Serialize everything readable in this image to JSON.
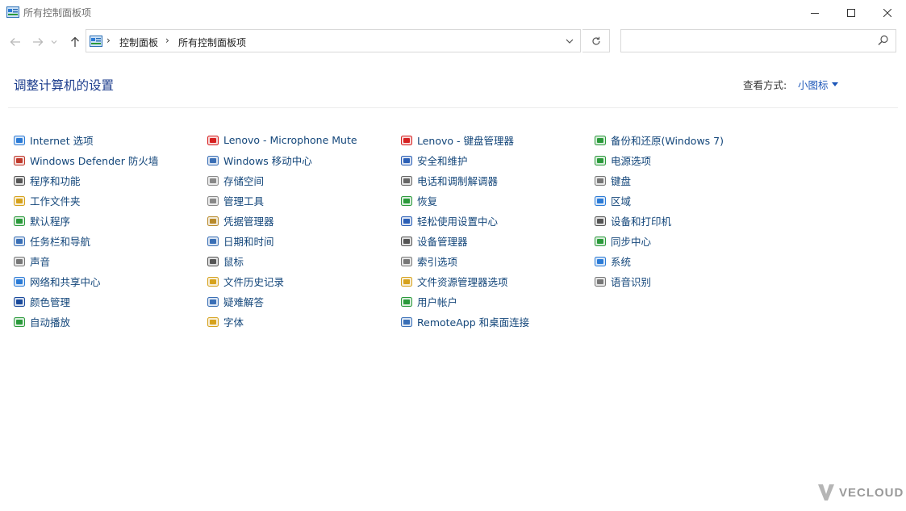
{
  "window": {
    "title": "所有控制面板项"
  },
  "address": {
    "crumbs": [
      "控制面板",
      "所有控制面板项"
    ],
    "search_placeholder": ""
  },
  "header": {
    "title": "调整计算机的设置",
    "view_label": "查看方式:",
    "view_value": "小图标"
  },
  "items": [
    {
      "label": "Internet 选项",
      "icon": "internet-options-icon",
      "color": "#2b7bd6"
    },
    {
      "label": "Windows Defender 防火墙",
      "icon": "firewall-icon",
      "color": "#c0392b"
    },
    {
      "label": "程序和功能",
      "icon": "programs-icon",
      "color": "#555"
    },
    {
      "label": "工作文件夹",
      "icon": "work-folders-icon",
      "color": "#d6a21c"
    },
    {
      "label": "默认程序",
      "icon": "default-programs-icon",
      "color": "#2b9a3b"
    },
    {
      "label": "任务栏和导航",
      "icon": "taskbar-icon",
      "color": "#3a6fb6"
    },
    {
      "label": "声音",
      "icon": "sound-icon",
      "color": "#777"
    },
    {
      "label": "网络和共享中心",
      "icon": "network-icon",
      "color": "#2b7bd6"
    },
    {
      "label": "颜色管理",
      "icon": "color-management-icon",
      "color": "#1a4a9c"
    },
    {
      "label": "自动播放",
      "icon": "autoplay-icon",
      "color": "#2b9a3b"
    },
    {
      "label": "Lenovo - Microphone Mute",
      "icon": "microphone-mute-icon",
      "color": "#d62020"
    },
    {
      "label": "Windows 移动中心",
      "icon": "mobility-center-icon",
      "color": "#3a6fb6"
    },
    {
      "label": "存储空间",
      "icon": "storage-spaces-icon",
      "color": "#888"
    },
    {
      "label": "管理工具",
      "icon": "admin-tools-icon",
      "color": "#888"
    },
    {
      "label": "凭据管理器",
      "icon": "credential-manager-icon",
      "color": "#b88a2b"
    },
    {
      "label": "日期和时间",
      "icon": "date-time-icon",
      "color": "#3a6fb6"
    },
    {
      "label": "鼠标",
      "icon": "mouse-icon",
      "color": "#555"
    },
    {
      "label": "文件历史记录",
      "icon": "file-history-icon",
      "color": "#d6a21c"
    },
    {
      "label": "疑难解答",
      "icon": "troubleshooting-icon",
      "color": "#3a6fb6"
    },
    {
      "label": "字体",
      "icon": "fonts-icon",
      "color": "#d6a21c"
    },
    {
      "label": "Lenovo - 键盘管理器",
      "icon": "keyboard-manager-icon",
      "color": "#d62020"
    },
    {
      "label": "安全和维护",
      "icon": "security-flag-icon",
      "color": "#2b5fb6"
    },
    {
      "label": "电话和调制解调器",
      "icon": "phone-modem-icon",
      "color": "#666"
    },
    {
      "label": "恢复",
      "icon": "recovery-icon",
      "color": "#2b9a3b"
    },
    {
      "label": "轻松使用设置中心",
      "icon": "ease-of-access-icon",
      "color": "#2b5fb6"
    },
    {
      "label": "设备管理器",
      "icon": "device-manager-icon",
      "color": "#555"
    },
    {
      "label": "索引选项",
      "icon": "indexing-options-icon",
      "color": "#777"
    },
    {
      "label": "文件资源管理器选项",
      "icon": "explorer-options-icon",
      "color": "#d6a21c"
    },
    {
      "label": "用户帐户",
      "icon": "user-accounts-icon",
      "color": "#2b9a3b"
    },
    {
      "label": "RemoteApp 和桌面连接",
      "icon": "remoteapp-icon",
      "color": "#3a6fb6"
    },
    {
      "label": "备份和还原(Windows 7)",
      "icon": "backup-restore-icon",
      "color": "#2b9a3b"
    },
    {
      "label": "电源选项",
      "icon": "power-options-icon",
      "color": "#2b9a3b"
    },
    {
      "label": "键盘",
      "icon": "keyboard-icon",
      "color": "#777"
    },
    {
      "label": "区域",
      "icon": "region-icon",
      "color": "#2b7bd6"
    },
    {
      "label": "设备和打印机",
      "icon": "devices-printers-icon",
      "color": "#555"
    },
    {
      "label": "同步中心",
      "icon": "sync-center-icon",
      "color": "#2b9a3b"
    },
    {
      "label": "系统",
      "icon": "system-icon",
      "color": "#2b7bd6"
    },
    {
      "label": "语音识别",
      "icon": "speech-recognition-icon",
      "color": "#777"
    }
  ],
  "watermark": {
    "text": "VECLOUD"
  }
}
